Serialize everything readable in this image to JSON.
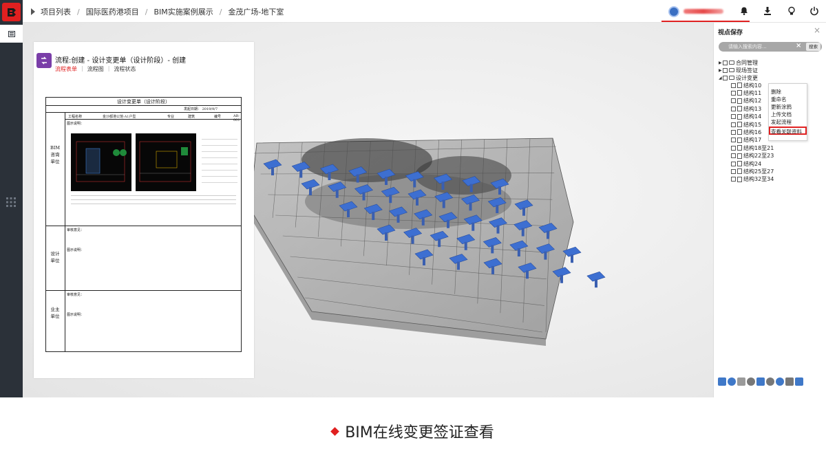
{
  "breadcrumb": [
    "项目列表",
    "国际医药港项目",
    "BIM实施案例展示",
    "金茂广场-地下室"
  ],
  "colors": {
    "accent": "#e02020",
    "rail": "#2b3139",
    "column_blue": "#3d6fd1",
    "form_logo": "#7a3ea8"
  },
  "document": {
    "title": "流程:创建 - 设计变更单（设计阶段）- 创建",
    "tabs": [
      "流程表单",
      "流程图",
      "流程状态"
    ],
    "form": {
      "heading": "设计变更单（设计阶段）",
      "date": "发起日期：  2019/9/7",
      "project_label": "工程名称",
      "project_value": "金沙都港公馆-A1户型",
      "major_label": "专业",
      "major_value": "建筑",
      "code_label": "编号",
      "code_value": "AR-001",
      "note_label": "图示说明：",
      "sections": [
        "BIM咨询单位",
        "设计单位",
        "业主单位"
      ],
      "review_label": "审核意见：",
      "diagram_label": "图示说明："
    }
  },
  "panel": {
    "title": "视点保存",
    "search_placeholder": "请输入搜索内容...",
    "search_button": "搜索",
    "tree": [
      {
        "label": "合同管理",
        "expanded": false
      },
      {
        "label": "现场签证",
        "expanded": false
      },
      {
        "label": "设计变更",
        "expanded": true
      }
    ],
    "children": [
      "结构10",
      "结构11",
      "结构12",
      "结构13",
      "结构14",
      "结构15",
      "结构16",
      "结构17",
      "结构18至21",
      "结构22至23",
      "结构24",
      "结构25至27",
      "结构32至34"
    ],
    "context_menu": [
      "删除",
      "重命名",
      "更新涂鸦",
      "上传文档",
      "发起流程",
      "查看关联资料"
    ]
  },
  "caption": "BIM在线变更签证查看"
}
